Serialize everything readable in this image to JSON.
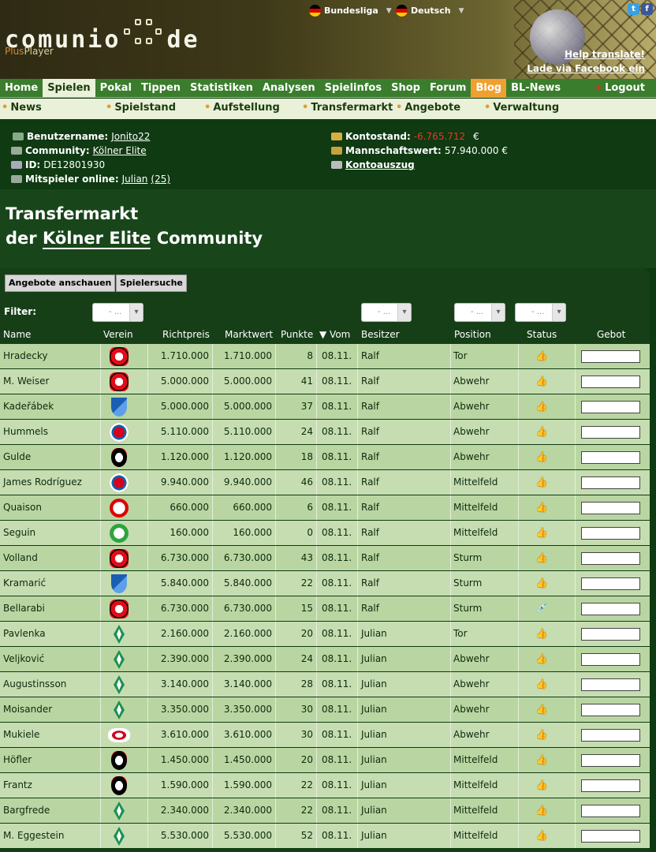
{
  "header": {
    "logo_left": "comunio",
    "logo_right": "de",
    "plus": "Plus",
    "player": "Player",
    "league": "Bundesliga",
    "language": "Deutsch",
    "help_translate": "Help translate!",
    "facebook_invite": "Lade via Facebook ein"
  },
  "nav": {
    "items": [
      "Home",
      "Spielen",
      "Pokal",
      "Tippen",
      "Statistiken",
      "Analysen",
      "Spielinfos",
      "Shop",
      "Forum",
      "Blog",
      "BL-News"
    ],
    "active": "Spielen",
    "logout": "Logout"
  },
  "subnav": [
    "News",
    "Spielstand",
    "Aufstellung",
    "Transfermarkt",
    "Angebote",
    "Verwaltung"
  ],
  "info": {
    "username_label": "Benutzername:",
    "username": "Jonito22",
    "community_label": "Community:",
    "community": "Kölner Elite",
    "id_label": "ID:",
    "id": "DE12801930",
    "online_label": "Mitspieler online:",
    "online_user": "Julian",
    "online_count": "(25)",
    "balance_label": "Kontostand:",
    "balance": "-6.765.712",
    "currency": "€",
    "teamvalue_label": "Mannschaftswert:",
    "teamvalue": "57.940.000 €",
    "statement": "Kontoauszug"
  },
  "title": {
    "line1": "Transfermarkt",
    "line2_pre": "der",
    "line2_link": "Kölner Elite",
    "line2_post": "Community"
  },
  "buttons": {
    "offers": "Angebote anschauen",
    "search": "Spielersuche"
  },
  "filter": {
    "label": "Filter:",
    "placeholder": "- ..."
  },
  "columns": {
    "name": "Name",
    "verein": "Verein",
    "richtpreis": "Richtpreis",
    "marktwert": "Marktwert",
    "punkte": "Punkte",
    "vom": "▼ Vom",
    "besitzer": "Besitzer",
    "position": "Position",
    "status": "Status",
    "gebot": "Gebot"
  },
  "rows": [
    {
      "name": "Hradecky",
      "club": "leverkusen",
      "richtpreis": "1.710.000",
      "marktwert": "1.710.000",
      "punkte": "8",
      "vom": "08.11.",
      "besitzer": "Ralf",
      "position": "Tor",
      "status": "thumb"
    },
    {
      "name": "M. Weiser",
      "club": "leverkusen",
      "richtpreis": "5.000.000",
      "marktwert": "5.000.000",
      "punkte": "41",
      "vom": "08.11.",
      "besitzer": "Ralf",
      "position": "Abwehr",
      "status": "thumb"
    },
    {
      "name": "Kadeřábek",
      "club": "hoffenheim",
      "richtpreis": "5.000.000",
      "marktwert": "5.000.000",
      "punkte": "37",
      "vom": "08.11.",
      "besitzer": "Ralf",
      "position": "Abwehr",
      "status": "thumb"
    },
    {
      "name": "Hummels",
      "club": "bayern",
      "richtpreis": "5.110.000",
      "marktwert": "5.110.000",
      "punkte": "24",
      "vom": "08.11.",
      "besitzer": "Ralf",
      "position": "Abwehr",
      "status": "thumb"
    },
    {
      "name": "Gulde",
      "club": "freiburg",
      "richtpreis": "1.120.000",
      "marktwert": "1.120.000",
      "punkte": "18",
      "vom": "08.11.",
      "besitzer": "Ralf",
      "position": "Abwehr",
      "status": "thumb"
    },
    {
      "name": "James Rodríguez",
      "club": "bayern",
      "richtpreis": "9.940.000",
      "marktwert": "9.940.000",
      "punkte": "46",
      "vom": "08.11.",
      "besitzer": "Ralf",
      "position": "Mittelfeld",
      "status": "thumb"
    },
    {
      "name": "Quaison",
      "club": "mainz",
      "richtpreis": "660.000",
      "marktwert": "660.000",
      "punkte": "6",
      "vom": "08.11.",
      "besitzer": "Ralf",
      "position": "Mittelfeld",
      "status": "thumb"
    },
    {
      "name": "Seguin",
      "club": "wolfsburg",
      "richtpreis": "160.000",
      "marktwert": "160.000",
      "punkte": "0",
      "vom": "08.11.",
      "besitzer": "Ralf",
      "position": "Mittelfeld",
      "status": "thumb"
    },
    {
      "name": "Volland",
      "club": "leverkusen",
      "richtpreis": "6.730.000",
      "marktwert": "6.730.000",
      "punkte": "43",
      "vom": "08.11.",
      "besitzer": "Ralf",
      "position": "Sturm",
      "status": "thumb"
    },
    {
      "name": "Kramarić",
      "club": "hoffenheim",
      "richtpreis": "5.840.000",
      "marktwert": "5.840.000",
      "punkte": "22",
      "vom": "08.11.",
      "besitzer": "Ralf",
      "position": "Sturm",
      "status": "thumb"
    },
    {
      "name": "Bellarabi",
      "club": "leverkusen",
      "richtpreis": "6.730.000",
      "marktwert": "6.730.000",
      "punkte": "15",
      "vom": "08.11.",
      "besitzer": "Ralf",
      "position": "Sturm",
      "status": "syringe"
    },
    {
      "name": "Pavlenka",
      "club": "bremen",
      "richtpreis": "2.160.000",
      "marktwert": "2.160.000",
      "punkte": "20",
      "vom": "08.11.",
      "besitzer": "Julian",
      "position": "Tor",
      "status": "thumb"
    },
    {
      "name": "Veljković",
      "club": "bremen",
      "richtpreis": "2.390.000",
      "marktwert": "2.390.000",
      "punkte": "24",
      "vom": "08.11.",
      "besitzer": "Julian",
      "position": "Abwehr",
      "status": "thumb"
    },
    {
      "name": "Augustinsson",
      "club": "bremen",
      "richtpreis": "3.140.000",
      "marktwert": "3.140.000",
      "punkte": "28",
      "vom": "08.11.",
      "besitzer": "Julian",
      "position": "Abwehr",
      "status": "thumb"
    },
    {
      "name": "Moisander",
      "club": "bremen",
      "richtpreis": "3.350.000",
      "marktwert": "3.350.000",
      "punkte": "30",
      "vom": "08.11.",
      "besitzer": "Julian",
      "position": "Abwehr",
      "status": "thumb"
    },
    {
      "name": "Mukiele",
      "club": "leipzig",
      "richtpreis": "3.610.000",
      "marktwert": "3.610.000",
      "punkte": "30",
      "vom": "08.11.",
      "besitzer": "Julian",
      "position": "Abwehr",
      "status": "thumb"
    },
    {
      "name": "Höfler",
      "club": "freiburg",
      "richtpreis": "1.450.000",
      "marktwert": "1.450.000",
      "punkte": "20",
      "vom": "08.11.",
      "besitzer": "Julian",
      "position": "Mittelfeld",
      "status": "thumb"
    },
    {
      "name": "Frantz",
      "club": "freiburg",
      "richtpreis": "1.590.000",
      "marktwert": "1.590.000",
      "punkte": "22",
      "vom": "08.11.",
      "besitzer": "Julian",
      "position": "Mittelfeld",
      "status": "thumb"
    },
    {
      "name": "Bargfrede",
      "club": "bremen",
      "richtpreis": "2.340.000",
      "marktwert": "2.340.000",
      "punkte": "22",
      "vom": "08.11.",
      "besitzer": "Julian",
      "position": "Mittelfeld",
      "status": "thumb"
    },
    {
      "name": "M. Eggestein",
      "club": "bremen",
      "richtpreis": "5.530.000",
      "marktwert": "5.530.000",
      "punkte": "52",
      "vom": "08.11.",
      "besitzer": "Julian",
      "position": "Mittelfeld",
      "status": "thumb"
    }
  ]
}
